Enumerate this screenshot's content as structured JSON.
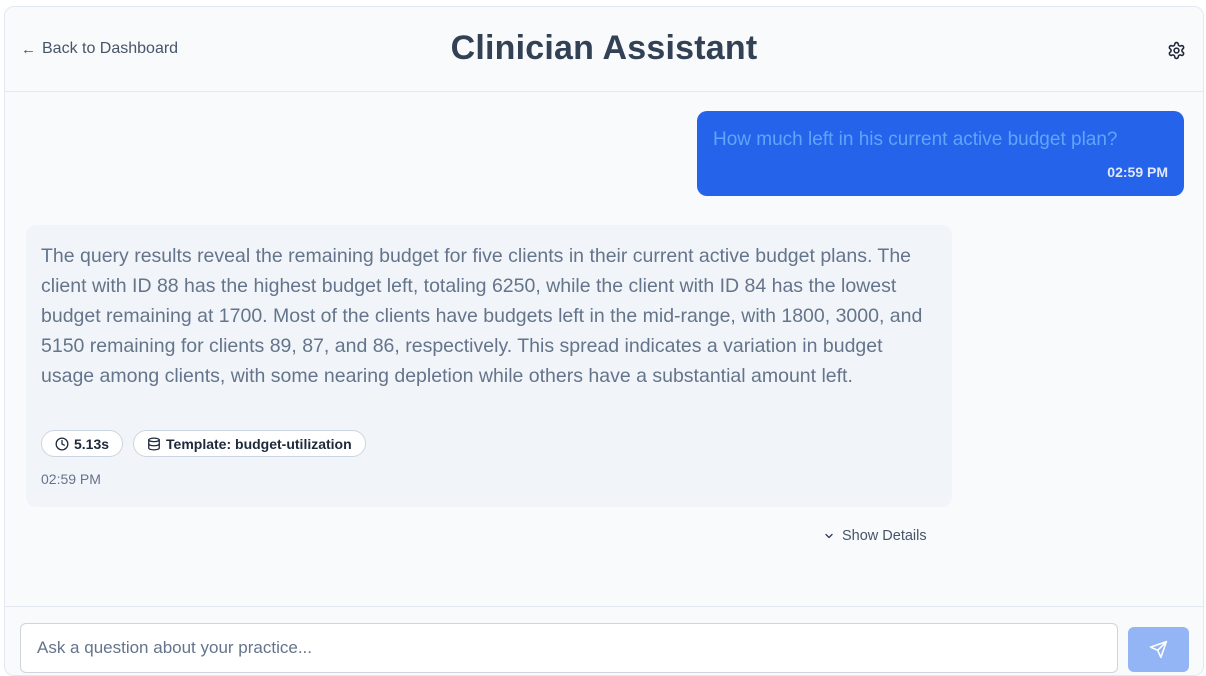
{
  "header": {
    "back_label": "Back to Dashboard",
    "back_icon": "arrow-left-icon",
    "title": "Clinician Assistant",
    "settings_icon": "gear-icon"
  },
  "messages": {
    "user": {
      "text": "How much left in his current active budget plan?",
      "time": "02:59 PM"
    },
    "assistant": {
      "text": "The query results reveal the remaining budget for five clients in their current active budget plans. The client with ID 88 has the highest budget left, totaling 6250, while the client with ID 84 has the lowest budget remaining at 1700. Most of the clients have budgets left in the mid-range, with 1800, 3000, and 5150 remaining for clients 89, 87, and 86, respectively. This spread indicates a variation in budget usage among clients, with some nearing depletion while others have a substantial amount left.",
      "duration": "5.13s",
      "duration_icon": "clock-icon",
      "template": "Template: budget-utilization",
      "template_icon": "database-icon",
      "time": "02:59 PM"
    }
  },
  "details": {
    "label": "Show Details",
    "icon": "chevron-down-icon"
  },
  "composer": {
    "placeholder": "Ask a question about your practice...",
    "send_icon": "send-icon"
  },
  "colors": {
    "user_bubble": "#2563eb",
    "send_button": "#93b4f5",
    "assistant_bubble": "#f1f5f9"
  }
}
